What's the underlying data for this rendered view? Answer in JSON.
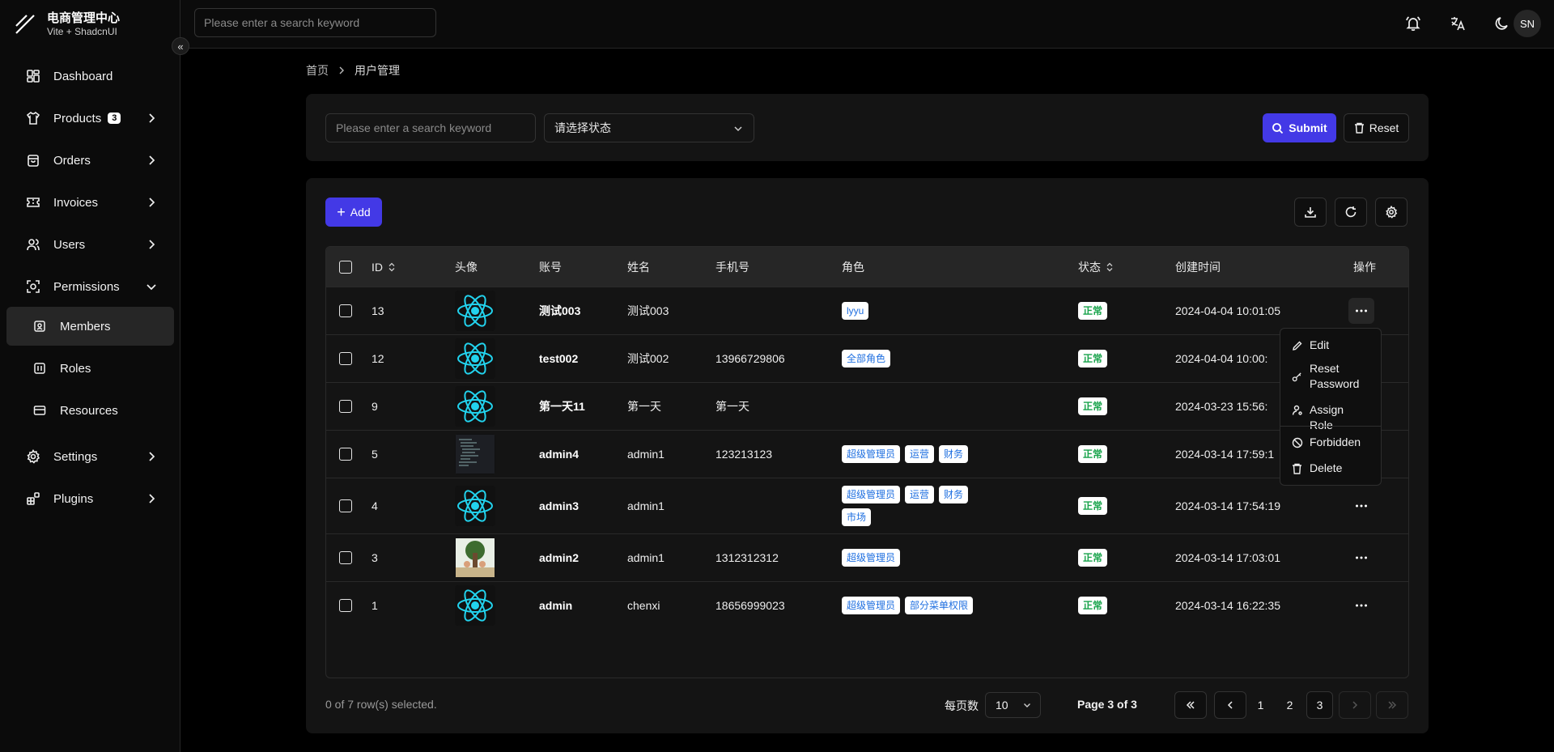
{
  "app": {
    "title": "电商管理中心",
    "subtitle": "Vite + ShadcnUI"
  },
  "header": {
    "search_placeholder": "Please enter a search keyword",
    "avatar_initials": "SN"
  },
  "sidebar": {
    "items": [
      {
        "label": "Dashboard",
        "icon": "dashboard-icon"
      },
      {
        "label": "Products",
        "icon": "shirt-icon",
        "badge": "3"
      },
      {
        "label": "Orders",
        "icon": "shopping-bag-icon"
      },
      {
        "label": "Invoices",
        "icon": "ticket-icon"
      },
      {
        "label": "Users",
        "icon": "users-icon"
      },
      {
        "label": "Permissions",
        "icon": "permissions-icon",
        "expanded": true
      },
      {
        "label": "Members",
        "icon": "contact-icon",
        "active": true
      },
      {
        "label": "Roles",
        "icon": "list-icon"
      },
      {
        "label": "Resources",
        "icon": "resource-icon"
      },
      {
        "label": "Settings",
        "icon": "gear-icon"
      },
      {
        "label": "Plugins",
        "icon": "blocks-icon"
      }
    ]
  },
  "breadcrumb": {
    "home": "首页",
    "current": "用户管理"
  },
  "filter": {
    "search_placeholder": "Please enter a search keyword",
    "status_placeholder": "请选择状态",
    "submit_label": "Submit",
    "reset_label": "Reset"
  },
  "toolbar": {
    "add_label": "Add"
  },
  "table": {
    "headers": {
      "id": "ID",
      "avatar": "头像",
      "account": "账号",
      "name": "姓名",
      "phone": "手机号",
      "role": "角色",
      "status": "状态",
      "created": "创建时间",
      "actions": "操作"
    },
    "rows": [
      {
        "id": "13",
        "account": "测试003",
        "name": "测试003",
        "phone": "",
        "roles": [
          "lyyu"
        ],
        "status": "正常",
        "created": "2024-04-04 10:01:05",
        "avatar": "react"
      },
      {
        "id": "12",
        "account": "test002",
        "name": "测试002",
        "phone": "13966729806",
        "roles": [
          "全部角色"
        ],
        "status": "正常",
        "created": "2024-04-04 10:00:",
        "avatar": "react"
      },
      {
        "id": "9",
        "account": "第一天11",
        "name": "第一天",
        "phone": "第一天",
        "roles": [],
        "status": "正常",
        "created": "2024-03-23 15:56:",
        "avatar": "react"
      },
      {
        "id": "5",
        "account": "admin4",
        "name": "admin1",
        "phone": "123213123",
        "roles": [
          "超级管理员",
          "运营",
          "财务"
        ],
        "status": "正常",
        "created": "2024-03-14 17:59:1",
        "avatar": "code"
      },
      {
        "id": "4",
        "account": "admin3",
        "name": "admin1",
        "phone": "",
        "roles": [
          "超级管理员",
          "运营",
          "财务",
          "市场"
        ],
        "status": "正常",
        "created": "2024-03-14 17:54:19",
        "avatar": "react"
      },
      {
        "id": "3",
        "account": "admin2",
        "name": "admin1",
        "phone": "1312312312",
        "roles": [
          "超级管理员"
        ],
        "status": "正常",
        "created": "2024-03-14 17:03:01",
        "avatar": "photo"
      },
      {
        "id": "1",
        "account": "admin",
        "name": "chenxi",
        "phone": "18656999023",
        "roles": [
          "超级管理员",
          "部分菜单权限"
        ],
        "status": "正常",
        "created": "2024-03-14 16:22:35",
        "avatar": "react"
      }
    ]
  },
  "row_menu": {
    "items": [
      {
        "label": "Edit",
        "icon": "pencil-icon"
      },
      {
        "label": "Reset\nPassword",
        "icon": "key-icon"
      },
      {
        "label": "Assign Role",
        "icon": "user-cog-icon"
      },
      {
        "label": "Forbidden",
        "icon": "ban-icon"
      },
      {
        "label": "Delete",
        "icon": "trash-icon"
      }
    ]
  },
  "footer": {
    "selection": "0 of 7 row(s) selected.",
    "per_page_label": "每页数",
    "per_page_value": "10",
    "page_text": "Page 3 of 3",
    "pages": [
      "1",
      "2",
      "3"
    ]
  },
  "colors": {
    "accent": "#4339e6",
    "tag_text": "#1f6fe0",
    "status_text": "#17a34a",
    "react": "#22d3ee"
  }
}
